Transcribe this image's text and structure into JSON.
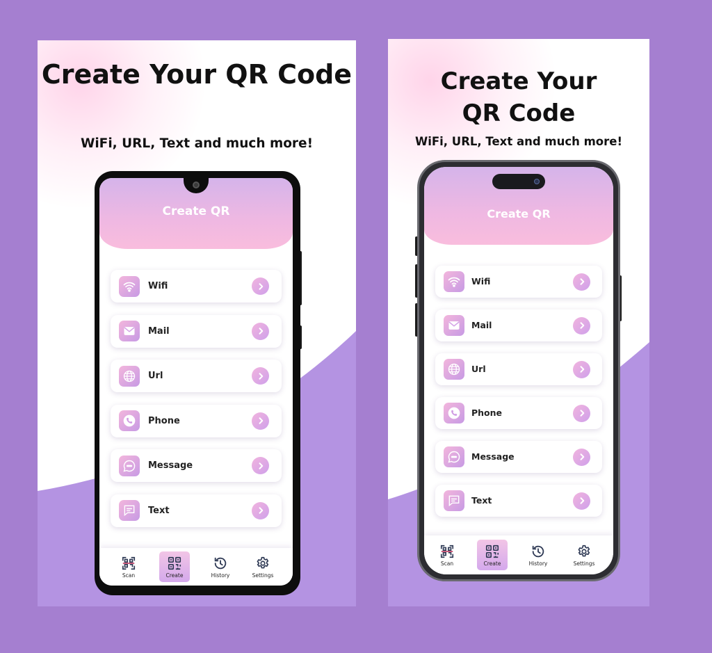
{
  "screens": [
    {
      "headline": "Create Your QR Code",
      "subheadline": "WiFi, URL, Text and much more!",
      "header_title": "Create QR",
      "items": [
        {
          "label": "Wifi",
          "icon": "wifi-icon"
        },
        {
          "label": "Mail",
          "icon": "mail-icon"
        },
        {
          "label": "Url",
          "icon": "globe-icon"
        },
        {
          "label": "Phone",
          "icon": "phone-icon"
        },
        {
          "label": "Message",
          "icon": "message-icon"
        },
        {
          "label": "Text",
          "icon": "text-icon"
        }
      ],
      "nav": [
        {
          "label": "Scan",
          "icon": "scan-icon"
        },
        {
          "label": "Create",
          "icon": "qr-code-icon",
          "active": true
        },
        {
          "label": "History",
          "icon": "history-icon"
        },
        {
          "label": "Settings",
          "icon": "gear-icon"
        }
      ]
    },
    {
      "headline_line1": "Create Your",
      "headline_line2": "QR Code",
      "subheadline": "WiFi, URL, Text and much more!",
      "header_title": "Create QR",
      "items": [
        {
          "label": "Wifi",
          "icon": "wifi-icon"
        },
        {
          "label": "Mail",
          "icon": "mail-icon"
        },
        {
          "label": "Url",
          "icon": "globe-icon"
        },
        {
          "label": "Phone",
          "icon": "phone-icon"
        },
        {
          "label": "Message",
          "icon": "message-icon"
        },
        {
          "label": "Text",
          "icon": "text-icon"
        }
      ],
      "nav": [
        {
          "label": "Scan",
          "icon": "scan-icon"
        },
        {
          "label": "Create",
          "icon": "qr-code-icon",
          "active": true
        },
        {
          "label": "History",
          "icon": "history-icon"
        },
        {
          "label": "Settings",
          "icon": "gear-icon"
        }
      ]
    }
  ],
  "colors": {
    "background": "#a57fd0",
    "wave": "#b493e2",
    "header_top": "#d5b4ea",
    "header_bottom": "#f9bddd",
    "accent": "#e4a8e0"
  }
}
